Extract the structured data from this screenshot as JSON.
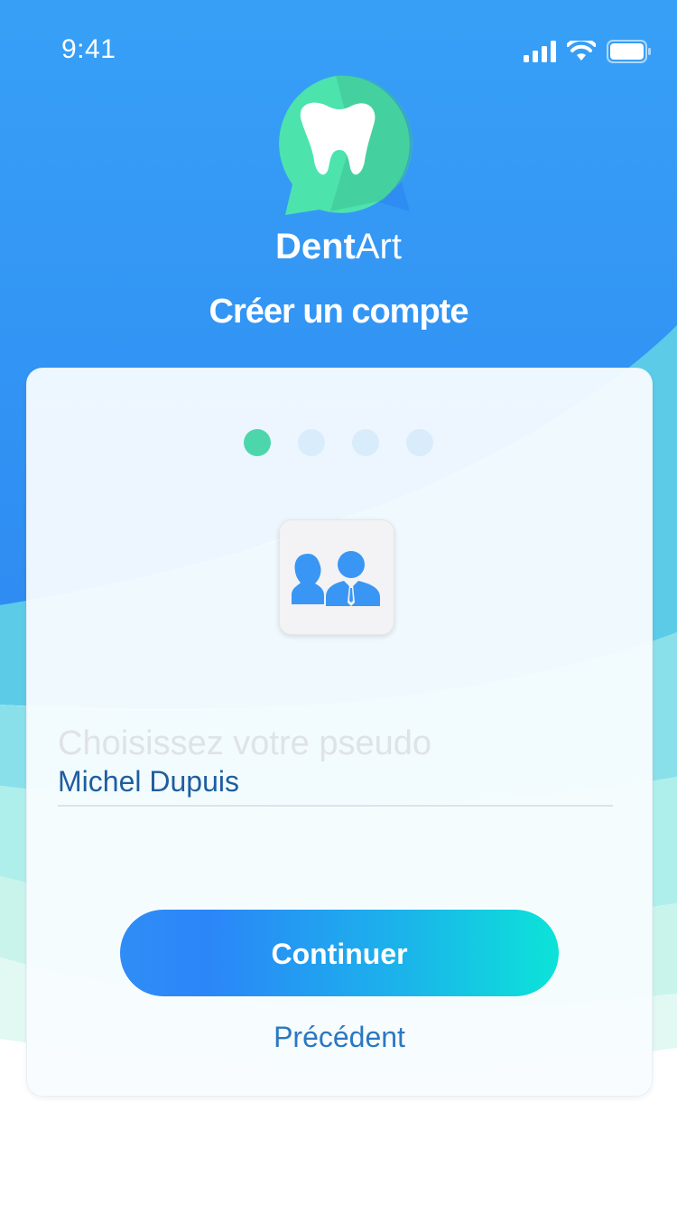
{
  "status_bar": {
    "time": "9:41",
    "icons": [
      "signal-icon",
      "wifi-icon",
      "battery-icon"
    ]
  },
  "brand": {
    "name_bold": "Dent",
    "name_light": "Art",
    "logo_icon": "tooth-chat-bubble-icon"
  },
  "page": {
    "title": "Créer un compte"
  },
  "stepper": {
    "total": 4,
    "current": 1
  },
  "avatar": {
    "icon": "users-icon"
  },
  "form": {
    "pseudo_placeholder": "Choisissez votre pseudo",
    "pseudo_value": "Michel Dupuis"
  },
  "actions": {
    "continue_label": "Continuer",
    "previous_label": "Précédent"
  },
  "colors": {
    "primary_blue": "#3598f5",
    "accent_green": "#4dd6ac",
    "link_blue": "#2a78c2",
    "gradient_end": "#0ce3d8"
  }
}
